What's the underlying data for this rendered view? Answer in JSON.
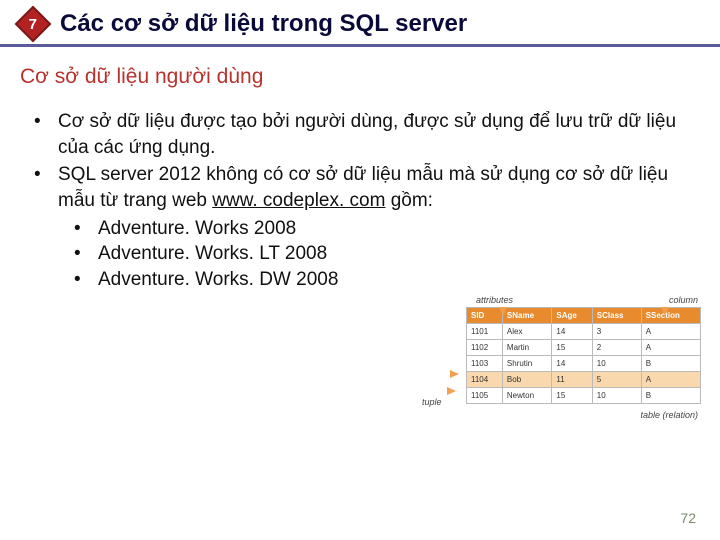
{
  "header": {
    "badge_number": "7",
    "title": "Các cơ sở dữ liệu trong SQL server"
  },
  "subtitle": "Cơ sở dữ liệu người dùng",
  "bullets": [
    "Cơ sở dữ liệu được tạo bởi người dùng, được sử dụng để lưu trữ dữ liệu của các ứng dụng.",
    "SQL server 2012 không có cơ sở dữ liệu mẫu mà sử dụng cơ sở dữ liệu mẫu từ trang web "
  ],
  "link_text": "www. codeplex. com",
  "link_suffix": " gồm:",
  "sub_bullets": [
    "Adventure. Works 2008",
    "Adventure. Works. LT 2008",
    "Adventure. Works. DW 2008"
  ],
  "figure": {
    "label_attributes": "attributes",
    "label_column": "column",
    "label_tuple": "tuple",
    "label_relation": "table (relation)",
    "headers": [
      "SID",
      "SName",
      "SAge",
      "SClass",
      "SSection"
    ],
    "rows": [
      [
        "1101",
        "Alex",
        "14",
        "3",
        "A"
      ],
      [
        "1102",
        "Martin",
        "15",
        "2",
        "A"
      ],
      [
        "1103",
        "Shrutin",
        "14",
        "10",
        "B"
      ],
      [
        "1104",
        "Bob",
        "11",
        "5",
        "A"
      ],
      [
        "1105",
        "Newton",
        "15",
        "10",
        "B"
      ]
    ],
    "highlight_row": 3
  },
  "page_number": "72"
}
